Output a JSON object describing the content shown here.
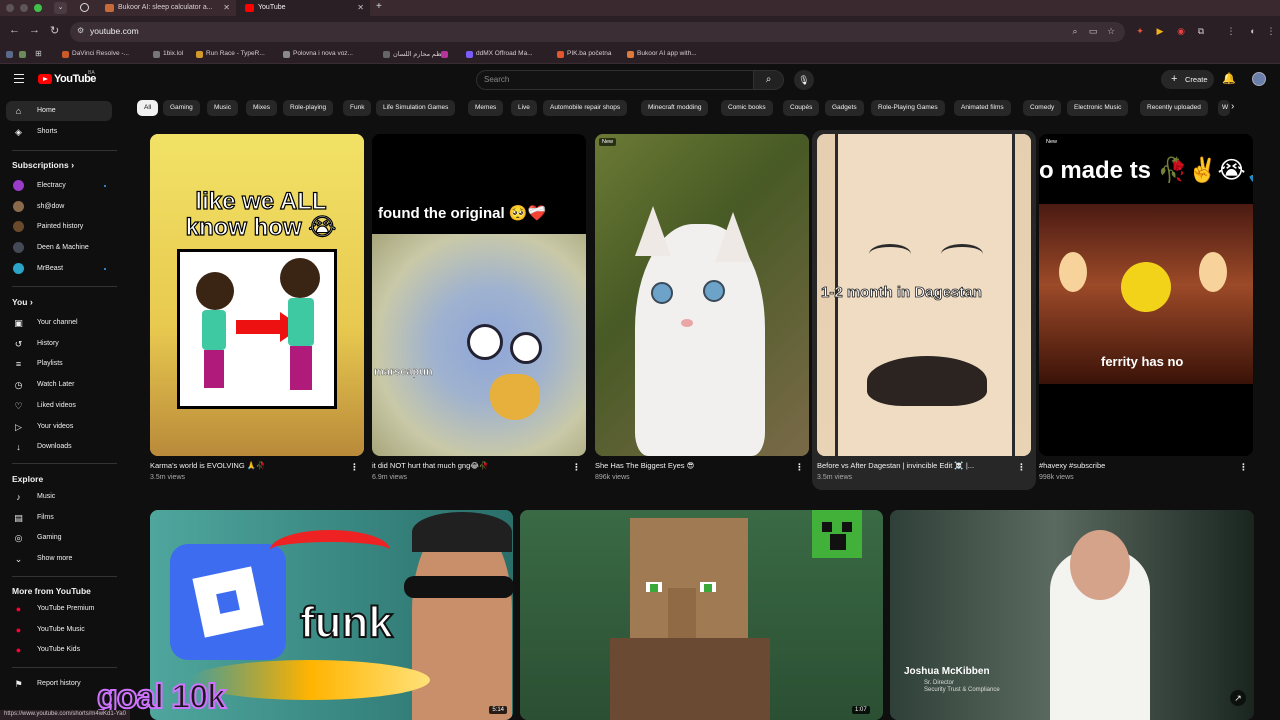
{
  "browser": {
    "tabs": [
      {
        "title": "Bukoor AI: sleep calculator a...",
        "active": false
      },
      {
        "title": "YouTube",
        "active": true
      }
    ],
    "new_tab": "+",
    "url": "youtube.com",
    "bookmarks": [
      {
        "label": "DaVinci Resolve -...",
        "color": "#c95a2a"
      },
      {
        "label": "1bix.lol",
        "color": "#777"
      },
      {
        "label": "Run Race - TypeR...",
        "color": "#d19a2b"
      },
      {
        "label": "Polovna i nova voz...",
        "color": "#8a8a8a"
      },
      {
        "label": "نظم محارم اللسان",
        "color": "#666"
      },
      {
        "label": "",
        "color": "#b5359c"
      },
      {
        "label": "ddMX Offroad Ma...",
        "color": "#7b5cff"
      },
      {
        "label": "PIK.ba početna",
        "color": "#e4572e"
      },
      {
        "label": "Bukoor AI app with...",
        "color": "#e07a38"
      }
    ]
  },
  "header": {
    "logo_text": "YouTube",
    "logo_country": "BA",
    "search_placeholder": "Search",
    "create_label": "Create"
  },
  "sidebar": {
    "top": [
      {
        "label": "Home",
        "icon": "home-icon",
        "glyph": "⌂",
        "active": true
      },
      {
        "label": "Shorts",
        "icon": "shorts-icon",
        "glyph": "◈",
        "active": false
      }
    ],
    "subscriptions_title": "Subscriptions",
    "subscriptions": [
      {
        "label": "Electracy",
        "color": "#9b3bc9",
        "dot": true
      },
      {
        "label": "sh@dow",
        "color": "#8a6a4a",
        "dot": false
      },
      {
        "label": "Painted history",
        "color": "#6a4a2a",
        "dot": false
      },
      {
        "label": "Deen & Machine",
        "color": "#444a55",
        "dot": false
      },
      {
        "label": "MrBeast",
        "color": "#2aa5c9",
        "dot": true
      }
    ],
    "you_title": "You",
    "you": [
      {
        "label": "Your channel",
        "icon": "your-channel-icon",
        "glyph": "▣"
      },
      {
        "label": "History",
        "icon": "history-icon",
        "glyph": "↺"
      },
      {
        "label": "Playlists",
        "icon": "playlists-icon",
        "glyph": "≡"
      },
      {
        "label": "Watch Later",
        "icon": "watch-later-icon",
        "glyph": "◷"
      },
      {
        "label": "Liked videos",
        "icon": "liked-videos-icon",
        "glyph": "♡"
      },
      {
        "label": "Your videos",
        "icon": "your-videos-icon",
        "glyph": "▷"
      },
      {
        "label": "Downloads",
        "icon": "downloads-icon",
        "glyph": "↓"
      }
    ],
    "explore_title": "Explore",
    "explore": [
      {
        "label": "Music",
        "icon": "music-icon",
        "glyph": "♪"
      },
      {
        "label": "Films",
        "icon": "films-icon",
        "glyph": "▤"
      },
      {
        "label": "Gaming",
        "icon": "gaming-icon",
        "glyph": "◎"
      },
      {
        "label": "Show more",
        "icon": "chevron-down-icon",
        "glyph": "⌄"
      }
    ],
    "more_title": "More from YouTube",
    "more": [
      {
        "label": "YouTube Premium",
        "color": "#ff0033"
      },
      {
        "label": "YouTube Music",
        "color": "#ff0033"
      },
      {
        "label": "YouTube Kids",
        "color": "#ff0033"
      }
    ],
    "report": {
      "label": "Report history",
      "icon": "flag-icon",
      "glyph": "⚑"
    }
  },
  "chips": [
    "All",
    "Gaming",
    "Music",
    "Mixes",
    "Role-playing",
    "Funk",
    "Life Simulation Games",
    "Memes",
    "Live",
    "Automobile repair shops",
    "Minecraft modding",
    "Comic books",
    "Coupés",
    "Gadgets",
    "Role-Playing Games",
    "Animated films",
    "Comedy",
    "Electronic Music",
    "Recently uploaded",
    "W"
  ],
  "shorts": [
    {
      "title": "Karma's world is EVOLVING 🙏🥀",
      "views": "3.5m views",
      "badge": "",
      "overlay": "like we ALL know how 😭"
    },
    {
      "title": "it did NOT hurt that much gng😂🥀",
      "views": "6.9m views",
      "badge": "",
      "overlay": "found the original 🥺❤️‍🩹",
      "overlay2": "marscapun"
    },
    {
      "title": "She Has The Biggest Eyes 😎",
      "views": "896k views",
      "badge": "New",
      "overlay": ""
    },
    {
      "title": "Before vs After Dagestan | invincible Edit ☠️ |...",
      "views": "3.5m views",
      "badge": "",
      "overlay": "1-2 month in Dagestan"
    },
    {
      "title": "#havexy #subscribe",
      "views": "998k views",
      "badge": "New",
      "overlay": "o made ts 🥀✌️😭🙏",
      "overlay2": "ferrity has no"
    }
  ],
  "videos": [
    {
      "overlay": "funk",
      "duration": "5:14"
    },
    {
      "overlay": "",
      "duration": "1:07"
    },
    {
      "overlay_name": "Joshua McKibben",
      "overlay_role": "Sr. Director",
      "overlay_role2": "Security Trust & Compliance",
      "duration": ""
    }
  ],
  "status_url": "https://www.youtube.com/shorts/m4wKd1-Ya0",
  "goal_text": "goal 10k"
}
